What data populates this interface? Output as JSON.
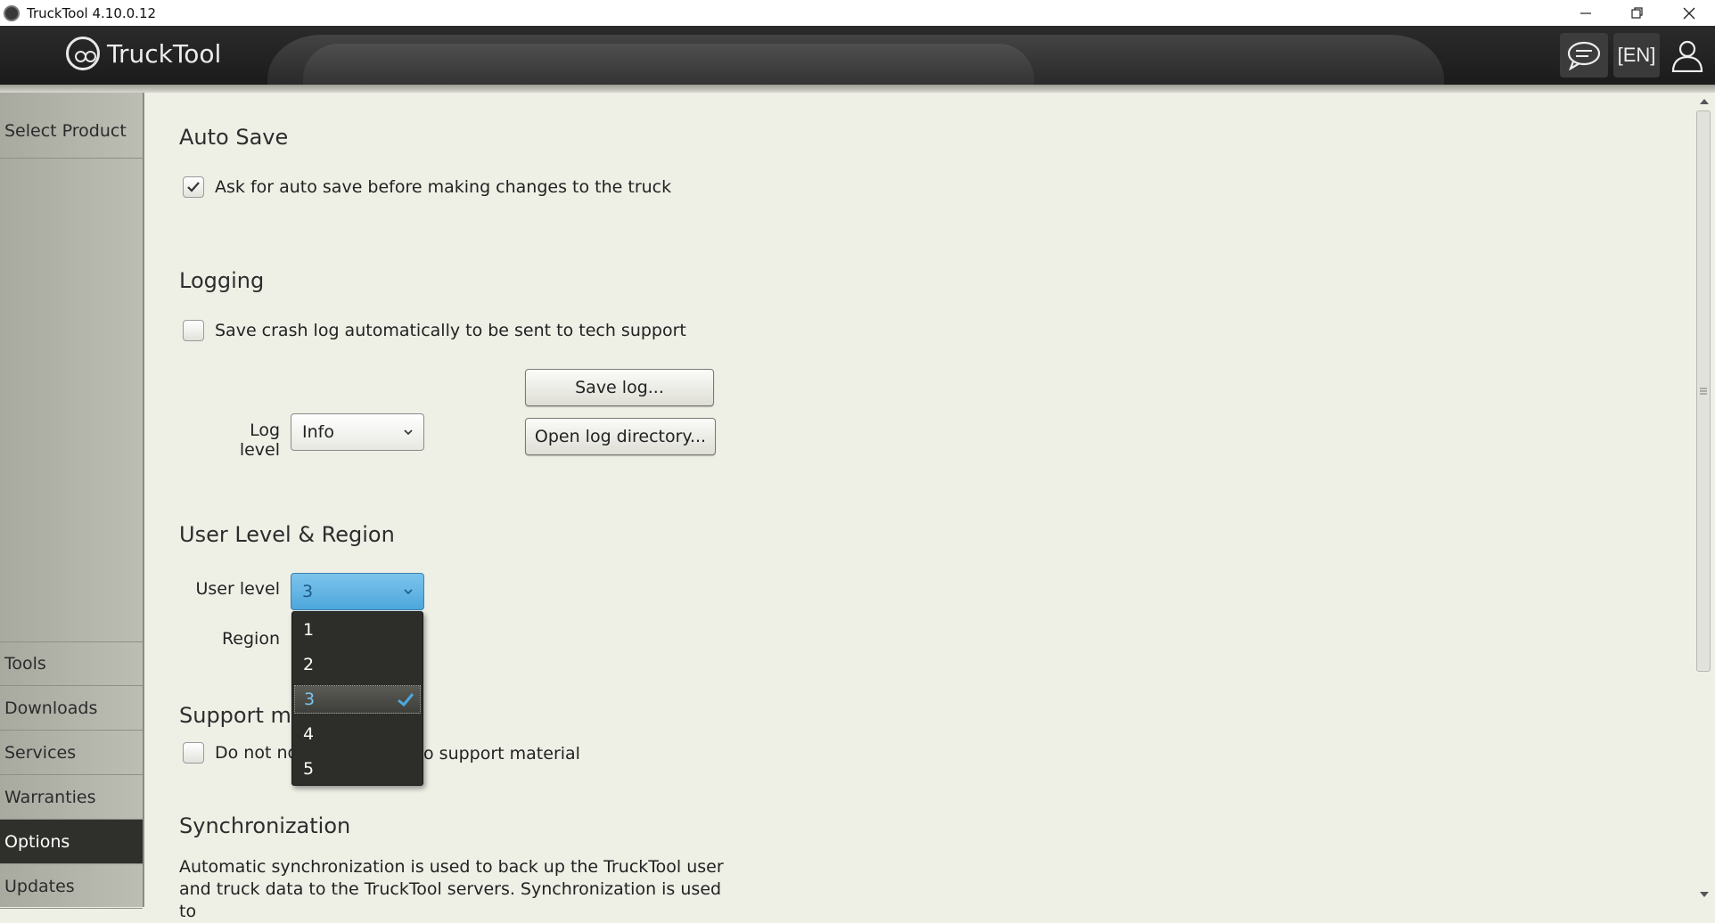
{
  "window": {
    "title": "TruckTool 4.10.0.12"
  },
  "header": {
    "logo_text": "TruckTool",
    "language": "[EN]",
    "icons": [
      "chat-icon",
      "user-icon"
    ]
  },
  "sidebar": {
    "top_item": "Select Product",
    "items": [
      {
        "label": "Tools",
        "active": false
      },
      {
        "label": "Downloads",
        "active": false
      },
      {
        "label": "Services",
        "active": false
      },
      {
        "label": "Warranties",
        "active": false
      },
      {
        "label": "Options",
        "active": true
      },
      {
        "label": "Updates",
        "active": false
      }
    ]
  },
  "main": {
    "auto_save": {
      "title": "Auto Save",
      "checkbox_label": "Ask for auto save before making changes to the truck",
      "checked": true
    },
    "logging": {
      "title": "Logging",
      "checkbox_label": "Save crash log automatically to be sent to tech support",
      "checked": false,
      "log_level_label": "Log level",
      "log_level_value": "Info",
      "save_log_button": "Save log...",
      "open_log_dir_button": "Open log directory..."
    },
    "user_level_region": {
      "title": "User Level & Region",
      "user_level_label": "User level",
      "user_level_value": "3",
      "region_label": "Region",
      "dropdown_options": [
        "1",
        "2",
        "3",
        "4",
        "5"
      ],
      "selected_option": "3"
    },
    "support_material": {
      "title_visible": "Support ma",
      "checkbox_label_left": "Do not no",
      "checkbox_label_right": "o support material",
      "checked": false
    },
    "synchronization": {
      "title": "Synchronization",
      "line1": "Automatic synchronization is used to back up the TruckTool user",
      "line2": "and truck data to the TruckTool servers. Synchronization is used to"
    }
  },
  "colors": {
    "accent": "#4ea7dc",
    "sidebar_active": "#2f302c",
    "background": "#eef0e6"
  }
}
